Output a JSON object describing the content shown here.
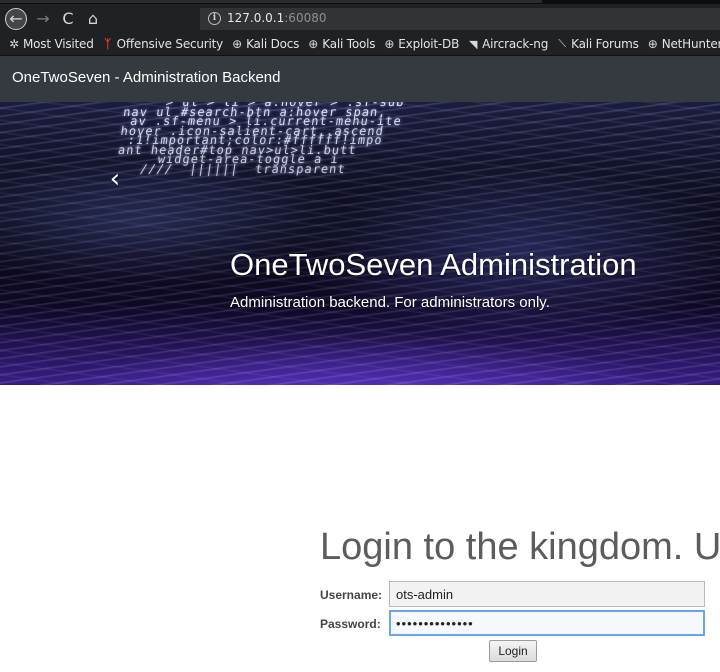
{
  "browser": {
    "url_host": "127.0.0.1",
    "url_port": ":60080",
    "icons": {
      "back": "back-arrow-icon",
      "forward": "forward-arrow-icon",
      "reload": "reload-icon",
      "home": "home-icon",
      "info": "info-icon"
    },
    "glyphs": {
      "back": "←",
      "forward": "→",
      "reload": "C",
      "home": "⌂",
      "info": "i"
    },
    "bookmarks": [
      {
        "label": "Most Visited",
        "icon": "gear-icon",
        "glyph": "✲"
      },
      {
        "label": "Offensive Security",
        "icon": "kali-dragon-icon",
        "glyph": "ᛉ"
      },
      {
        "label": "Kali Docs",
        "icon": "globe-icon",
        "glyph": "⊕"
      },
      {
        "label": "Kali Tools",
        "icon": "globe-icon",
        "glyph": "⊕"
      },
      {
        "label": "Exploit-DB",
        "icon": "globe-icon",
        "glyph": "⊕"
      },
      {
        "label": "Aircrack-ng",
        "icon": "aircrack-icon",
        "glyph": "◥"
      },
      {
        "label": "Kali Forums",
        "icon": "kali-forums-icon",
        "glyph": "⟍"
      },
      {
        "label": "NetHunter",
        "icon": "globe-icon",
        "glyph": "⊕"
      }
    ]
  },
  "site": {
    "brand": "OneTwoSeven - Administration Backend"
  },
  "hero": {
    "title": "OneTwoSeven Administration",
    "subtitle": "Administration backend. For administrators only.",
    "prev_glyph": "‹",
    "code_lines": [
      "     > ul > li > a:hover > .sf-sub",
      "nav ul #search-btn a:hover span,",
      " av .sf-menu > li.current-menu-ite",
      "hover .icon-salient-cart,.ascend",
      " :1!important;color:#ffffff!impo",
      "ant header#top nav>ul>li.butt",
      "     widget-area-toggle a i",
      "   ////  ||||||  transparent"
    ]
  },
  "login": {
    "heading": "Login to the kingdom. U",
    "username_label": "Username:",
    "password_label": "Password:",
    "username_value": "ots-admin",
    "password_value": "••••••••••••••",
    "submit_label": "Login"
  }
}
